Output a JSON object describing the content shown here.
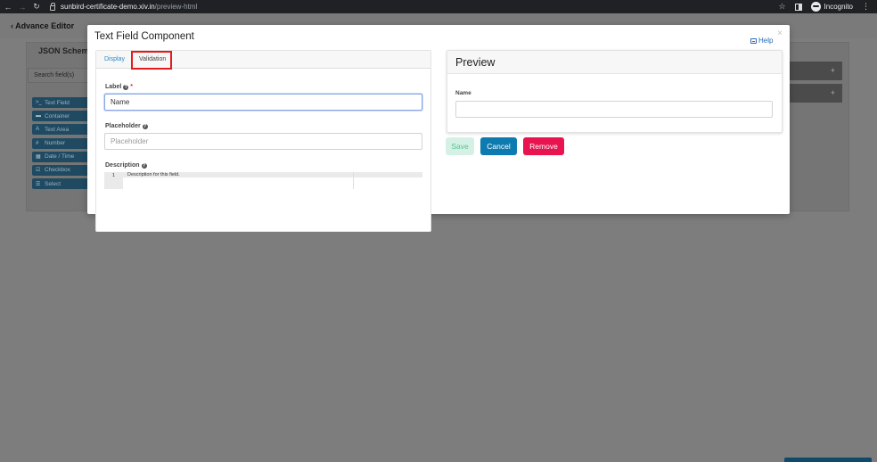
{
  "browser": {
    "url_host": "sunbird-certificate-demo.xiv.in",
    "url_path": "/preview-html",
    "profile_label": "Incognito"
  },
  "background": {
    "back_label": "Advance Editor",
    "json_schema_title": "JSON Schema",
    "search_placeholder": "Search field(s)",
    "components": [
      {
        "icon": "terminal-icon",
        "glyph": ">_",
        "label": "Text Field"
      },
      {
        "icon": "folder-icon",
        "glyph": "▬",
        "label": "Container"
      },
      {
        "icon": "font-icon",
        "glyph": "A",
        "label": "Text Area"
      },
      {
        "icon": "hash-icon",
        "glyph": "#",
        "label": "Number"
      },
      {
        "icon": "calendar-icon",
        "glyph": "▦",
        "label": "Date / Time"
      },
      {
        "icon": "checkbox-icon",
        "glyph": "☑",
        "label": "Checkbox"
      },
      {
        "icon": "list-icon",
        "glyph": "☰",
        "label": "Select"
      }
    ],
    "add_glyph": "+"
  },
  "modal": {
    "title": "Text Field Component",
    "help_label": "Help",
    "close_glyph": "×",
    "tabs": {
      "display": "Display",
      "validation": "Validation"
    },
    "fields": {
      "label": {
        "label": "Label",
        "required_mark": "*",
        "value": "Name"
      },
      "placeholder": {
        "label": "Placeholder",
        "placeholder": "Placeholder"
      },
      "description": {
        "label": "Description",
        "line_number": "1",
        "value": "Description for this field."
      }
    },
    "preview": {
      "title": "Preview",
      "field_label": "Name"
    },
    "buttons": {
      "save": "Save",
      "cancel": "Cancel",
      "remove": "Remove"
    }
  },
  "colors": {
    "highlight": "#e31b1b",
    "cancel": "#0e7bb0",
    "remove": "#e8134f",
    "save_bg": "#d5f1e5"
  }
}
